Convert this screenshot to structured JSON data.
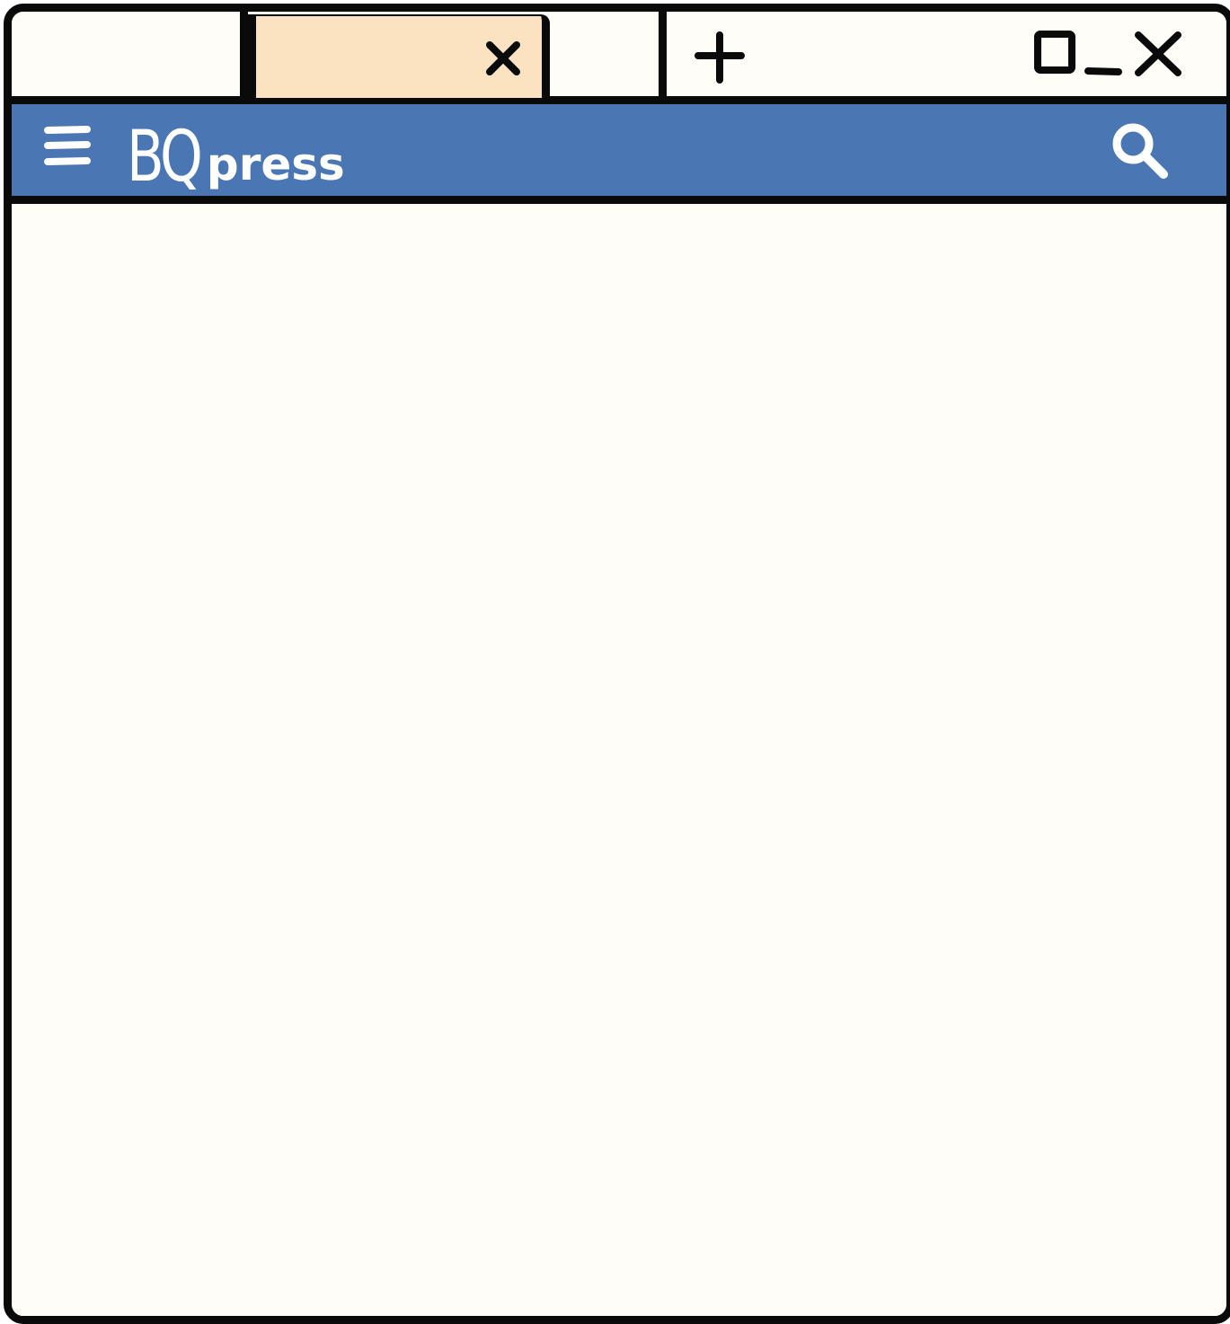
{
  "logo": {
    "main": "BQ",
    "sub": "press"
  },
  "icons": {
    "tab_close": "close-icon",
    "new_tab": "plus-icon",
    "maximize": "maximize-icon",
    "minimize": "minimize-icon",
    "window_close": "close-icon",
    "menu": "hamburger-menu-icon",
    "search": "search-icon"
  },
  "colors": {
    "header_bar": "#4a77b3",
    "active_tab": "#fbe3c1",
    "window_background": "#fffdf8",
    "outline": "#0a0a0a",
    "logo_text": "#ffffff"
  }
}
